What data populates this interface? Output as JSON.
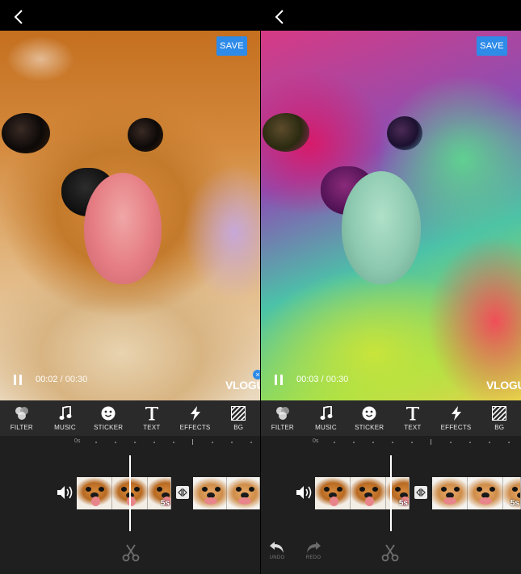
{
  "panels": [
    {
      "id": "left",
      "save_label": "SAVE",
      "time_current": "00:02",
      "time_sep": " / ",
      "time_total": "00:30",
      "watermark": "VLOGU",
      "tools": [
        {
          "label": "FILTER",
          "icon": "filter-icon"
        },
        {
          "label": "MUSIC",
          "icon": "music-icon"
        },
        {
          "label": "STICKER",
          "icon": "sticker-icon"
        },
        {
          "label": "TEXT",
          "icon": "text-icon"
        },
        {
          "label": "EFFECTS",
          "icon": "effects-icon"
        },
        {
          "label": "BG",
          "icon": "bg-icon"
        }
      ],
      "ruler_start": "0s",
      "clip_durations": [
        "5s",
        "5s"
      ],
      "history": null
    },
    {
      "id": "right",
      "save_label": "SAVE",
      "time_current": "00:03",
      "time_sep": " / ",
      "time_total": "00:30",
      "watermark": "VLOGU",
      "tools": [
        {
          "label": "FILTER",
          "icon": "filter-icon"
        },
        {
          "label": "MUSIC",
          "icon": "music-icon"
        },
        {
          "label": "STICKER",
          "icon": "sticker-icon"
        },
        {
          "label": "TEXT",
          "icon": "text-icon"
        },
        {
          "label": "EFFECTS",
          "icon": "effects-icon"
        },
        {
          "label": "BG",
          "icon": "bg-icon"
        }
      ],
      "ruler_start": "0s",
      "clip_durations": [
        "5s",
        "5s"
      ],
      "history": {
        "undo_label": "UNDO",
        "redo_label": "REDO"
      }
    }
  ],
  "colors": {
    "accent": "#2e8be8",
    "toolbar_bg": "#2a2a2a",
    "timeline_bg": "#1f1f1f"
  }
}
